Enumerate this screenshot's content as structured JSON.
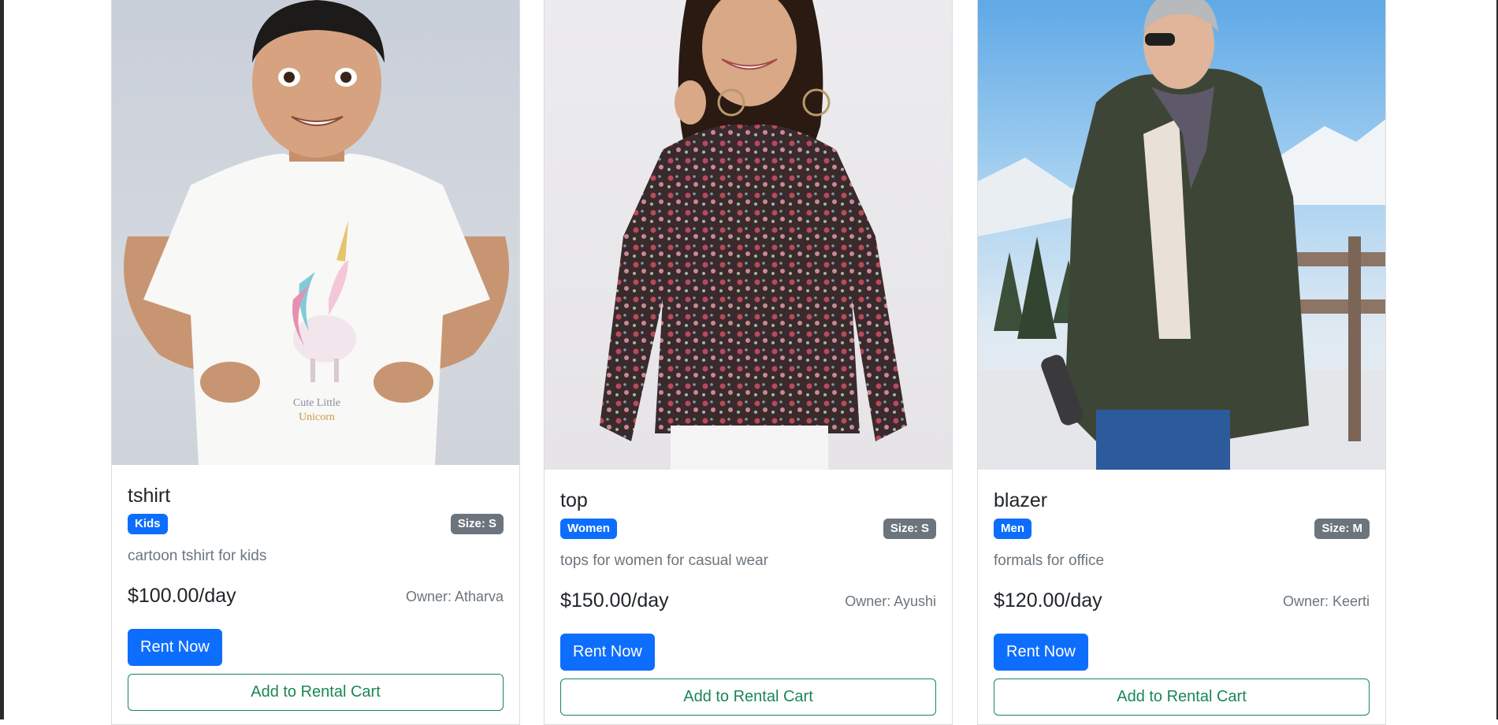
{
  "products": [
    {
      "title": "tshirt",
      "category": "Kids",
      "size": "Size: S",
      "description": "cartoon tshirt for kids",
      "price": "$100.00/day",
      "owner": "Owner: Atharva",
      "rent_label": "Rent Now",
      "cart_label": "Add to Rental Cart",
      "image_alt": "child wearing white unicorn t-shirt",
      "shirt_print": [
        "Cute Little",
        "Unicorn"
      ]
    },
    {
      "title": "top",
      "category": "Women",
      "size": "Size: S",
      "description": "tops for women for casual wear",
      "price": "$150.00/day",
      "owner": "Owner: Ayushi",
      "rent_label": "Rent Now",
      "cart_label": "Add to Rental Cart",
      "image_alt": "woman wearing floral print top"
    },
    {
      "title": "blazer",
      "category": "Men",
      "size": "Size: M",
      "description": "formals for office",
      "price": "$120.00/day",
      "owner": "Owner: Keerti",
      "rent_label": "Rent Now",
      "cart_label": "Add to Rental Cart",
      "image_alt": "man wearing green puffer jacket in snowy mountains"
    }
  ],
  "colors": {
    "primary": "#0d6efd",
    "secondary": "#6c757d",
    "success": "#198754",
    "text": "#212529"
  }
}
